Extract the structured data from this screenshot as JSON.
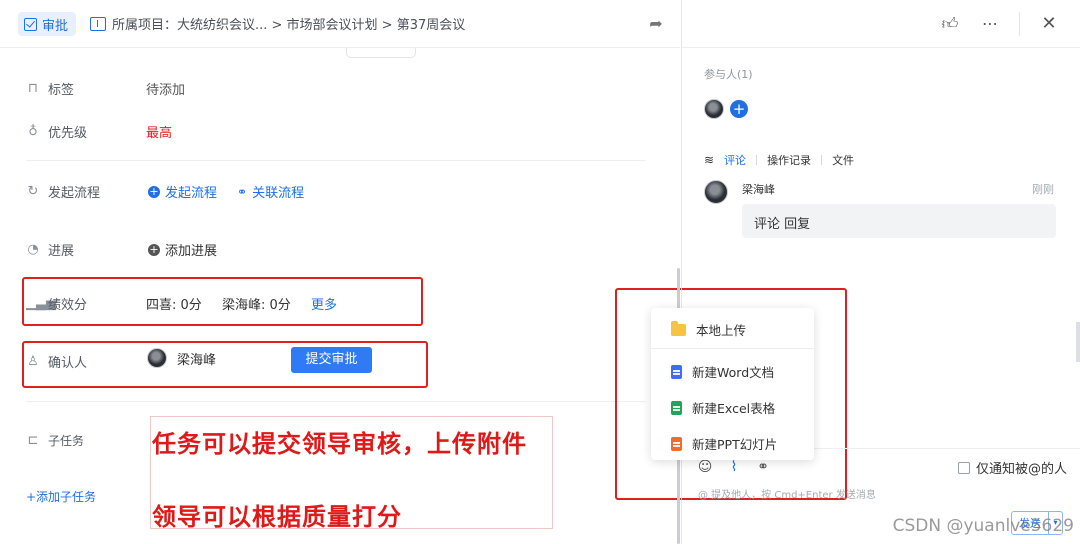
{
  "header": {
    "badge_label": "审批",
    "breadcrumb": "所属项目：大统纺织会议... > 市场部会议计划 > 第37周会议"
  },
  "fields": {
    "tag": {
      "label": "标签",
      "value": "待添加"
    },
    "priority": {
      "label": "优先级",
      "value": "最高"
    },
    "flow": {
      "label": "发起流程",
      "start_flow": "发起流程",
      "link_flow": "关联流程"
    },
    "progress": {
      "label": "进展",
      "add_progress": "添加进展"
    },
    "score": {
      "label": "绩效分",
      "entry1": "四喜: 0分",
      "entry2": "梁海峰: 0分",
      "more": "更多"
    },
    "confirmer": {
      "label": "确认人",
      "name": "梁海峰",
      "submit": "提交审批"
    },
    "subtask": {
      "label": "子任务",
      "add": "+添加子任务"
    }
  },
  "annotation": {
    "line1": "任务可以提交领导审核，上传附件",
    "line2": "领导可以根据质量打分"
  },
  "right_panel": {
    "participants_label": "参与人(1)",
    "tabs": [
      "评论",
      "操作记录",
      "文件"
    ],
    "comment": {
      "author": "梁海峰",
      "time": "刚刚",
      "text": "评论 回复"
    },
    "notify_label": "仅通知被@的人",
    "hint": "@ 提及他人，按 Cmd+Enter 发送消息",
    "send_label": "发送"
  },
  "upload_menu": {
    "items": [
      "本地上传",
      "新建Word文档",
      "新建Excel表格",
      "新建PPT幻灯片"
    ],
    "colors": {
      "folder": "#f6c343",
      "word": "#3b6ef5",
      "excel": "#22a55b",
      "ppt": "#f26b2d"
    }
  },
  "watermark": "CSDN @yuanlve5629",
  "colors": {
    "accent": "#1f6fe5",
    "priority_high": "#e02020",
    "annotation": "#e01818"
  }
}
